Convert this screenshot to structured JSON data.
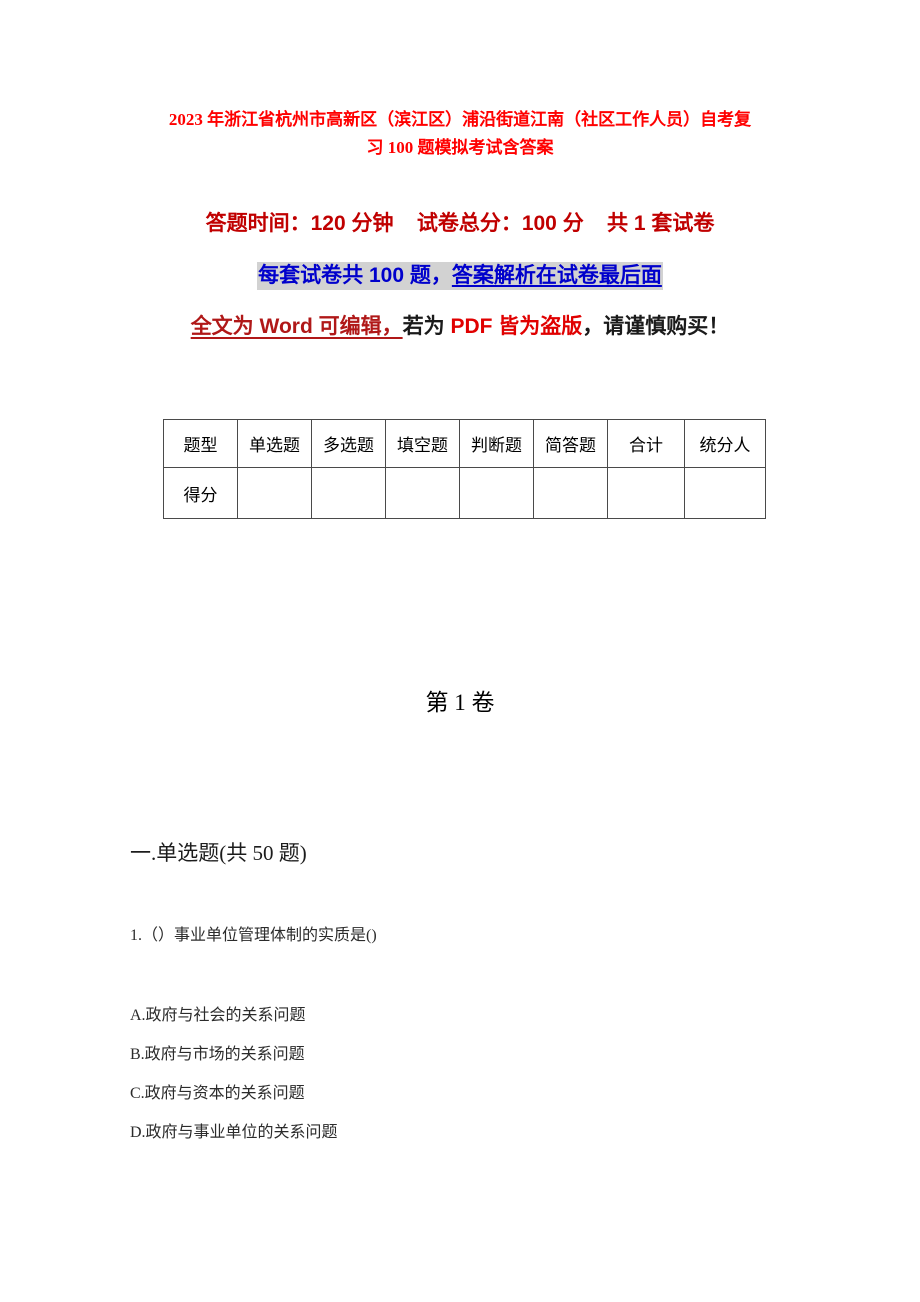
{
  "document": {
    "title_line_1": "2023 年浙江省杭州市高新区（滨江区）浦沿街道江南（社区工作人员）自考复",
    "title_line_2": "习 100 题模拟考试含答案",
    "title_color": "#FF0000"
  },
  "exam_info": {
    "line1": "答题时间：120 分钟    试卷总分：100 分    共 1 套试卷",
    "line1_color": "#C00000",
    "line2_plain": "每套试卷共 100 题，",
    "line2_underlined": "答案解析在试卷最后面",
    "line2_color": "#0000CC",
    "line2_highlight_color": "#D2D2D2",
    "line3_part1": "全文为 Word 可编辑，",
    "line3_part2": "若为 ",
    "line3_part3": "PDF 皆为盗版",
    "line3_part4": "，请谨慎购买！",
    "line3_part1_color": "#B01818",
    "line3_part3_color": "#E00000"
  },
  "score_table": {
    "headers": [
      "题型",
      "单选题",
      "多选题",
      "填空题",
      "判断题",
      "简答题",
      "合计",
      "统分人"
    ],
    "rows": [
      [
        "得分",
        "",
        "",
        "",
        "",
        "",
        "",
        ""
      ]
    ]
  },
  "volume": {
    "heading": "第 1 卷"
  },
  "section": {
    "heading": "一.单选题(共 50 题)"
  },
  "questions": [
    {
      "number": "1.",
      "text": "1.（）事业单位管理体制的实质是()",
      "options": [
        "A.政府与社会的关系问题",
        "B.政府与市场的关系问题",
        "C.政府与资本的关系问题",
        "D.政府与事业单位的关系问题"
      ]
    }
  ]
}
